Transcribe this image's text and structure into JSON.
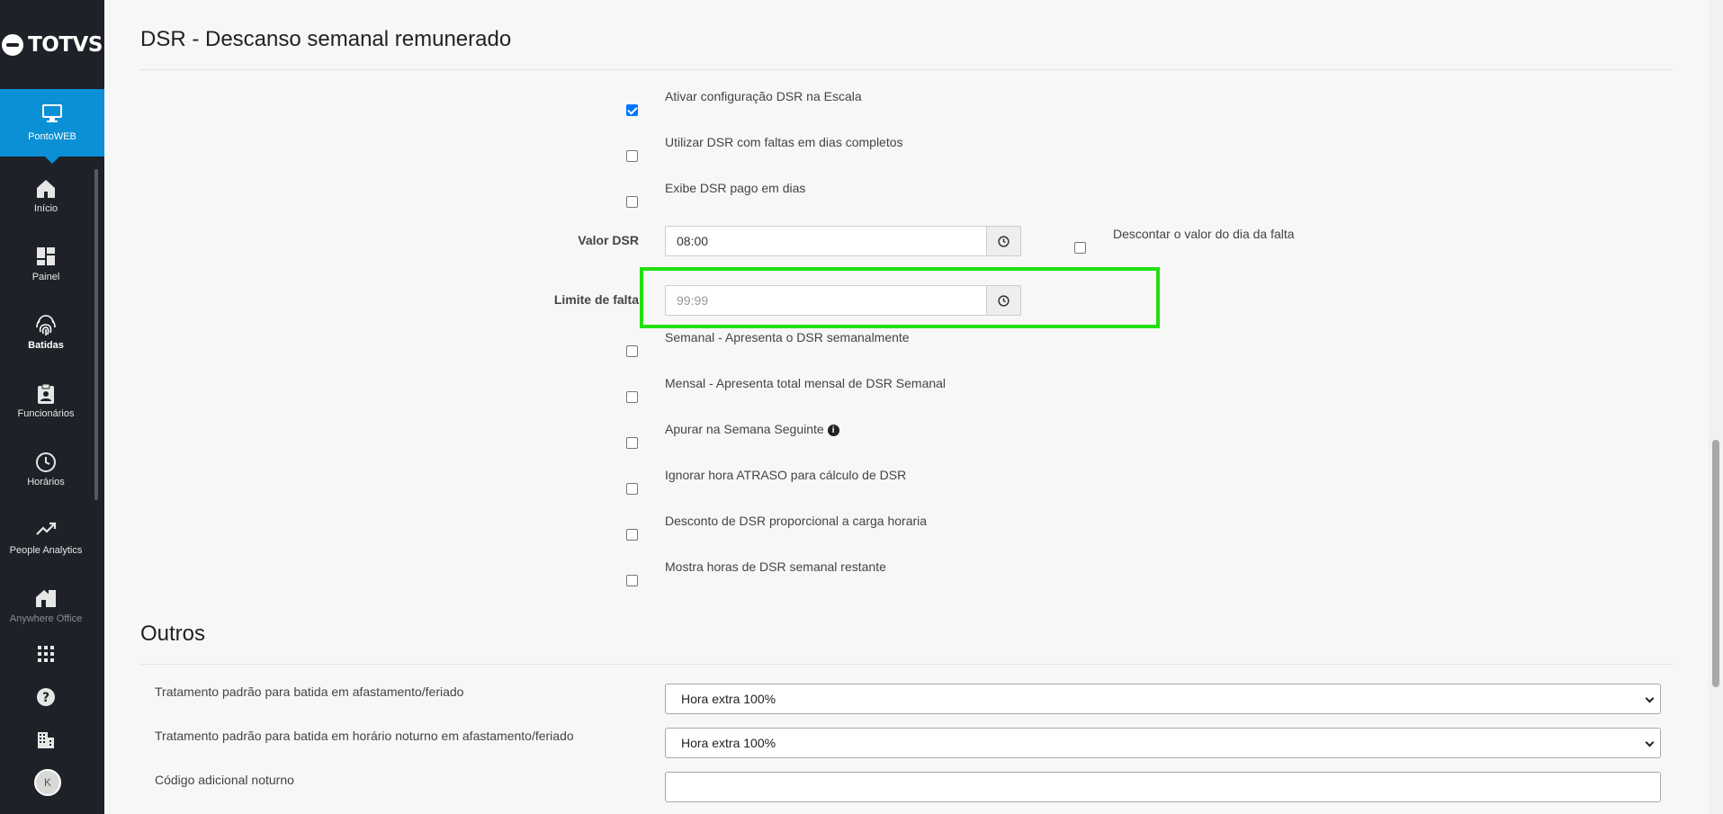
{
  "brand": {
    "name": "TOTVS"
  },
  "sidebar": {
    "active": {
      "label": "PontoWEB",
      "icon": "monitor-icon"
    },
    "items": [
      {
        "label": "Início",
        "icon": "home-icon"
      },
      {
        "label": "Painel",
        "icon": "dashboard-icon"
      },
      {
        "label": "Batidas",
        "icon": "fingerprint-icon"
      },
      {
        "label": "Funcionários",
        "icon": "clipboard-user-icon"
      },
      {
        "label": "Horários",
        "icon": "clock-icon"
      },
      {
        "label": "People Analytics",
        "icon": "trend-icon"
      },
      {
        "label": "Anywhere Office",
        "icon": "house-office-icon"
      }
    ],
    "bottom": {
      "apps_icon": "grid-icon",
      "help_icon": "help-icon",
      "company_icon": "building-icon",
      "avatar_initial": "K"
    }
  },
  "dsr": {
    "title": "DSR - Descanso semanal remunerado",
    "options_top": [
      {
        "label": "Ativar configuração DSR na Escala",
        "checked": true
      },
      {
        "label": "Utilizar DSR com faltas em dias completos",
        "checked": false
      },
      {
        "label": "Exibe DSR pago em dias",
        "checked": false
      }
    ],
    "valor_dsr": {
      "label": "Valor DSR",
      "value": "08:00"
    },
    "descontar": {
      "label": "Descontar o valor do dia da falta",
      "checked": false
    },
    "limite_falta": {
      "label": "Limite de falta",
      "placeholder": "99:99"
    },
    "options_bottom": [
      {
        "label": "Semanal - Apresenta o DSR semanalmente",
        "checked": false
      },
      {
        "label": "Mensal - Apresenta total mensal de DSR Semanal",
        "checked": false
      },
      {
        "label": "Apurar na Semana Seguinte",
        "checked": false,
        "info": true
      },
      {
        "label": "Ignorar hora ATRASO para cálculo de DSR",
        "checked": false
      },
      {
        "label": "Desconto de DSR proporcional a carga horaria",
        "checked": false
      },
      {
        "label": "Mostra horas de DSR semanal restante",
        "checked": false
      }
    ]
  },
  "outros": {
    "title": "Outros",
    "rows": [
      {
        "label": "Tratamento padrão para batida em afastamento/feriado",
        "value": "Hora extra 100%"
      },
      {
        "label": "Tratamento padrão para batida em horário noturno em afastamento/feriado",
        "value": "Hora extra 100%"
      },
      {
        "label": "Código adicional noturno",
        "value": ""
      }
    ]
  },
  "colors": {
    "sidebar": "#1e2228",
    "active": "#0b90d6",
    "highlight": "#22e010",
    "checkbox": "#0075ff"
  }
}
